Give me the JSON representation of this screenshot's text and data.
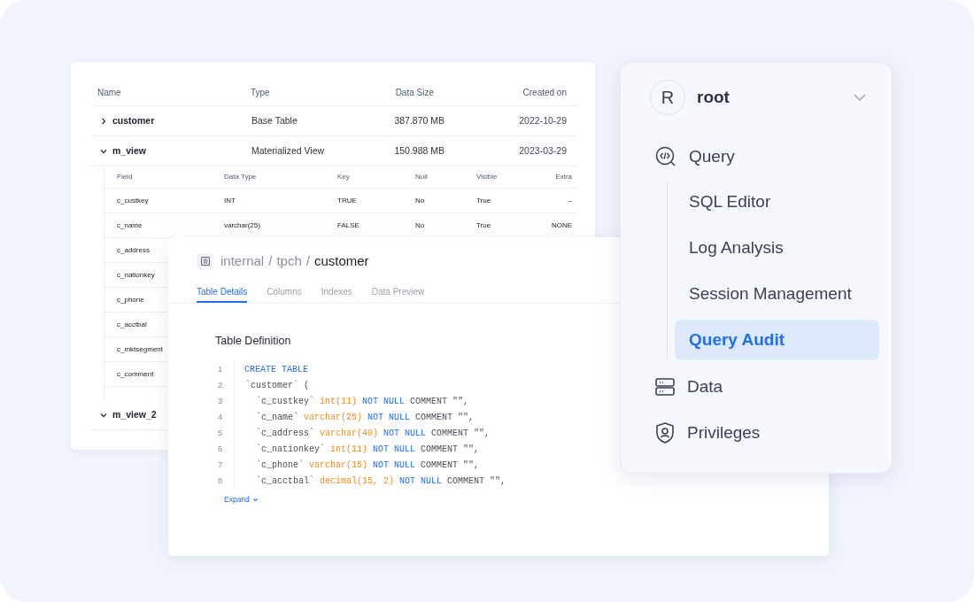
{
  "tables_card": {
    "columns": [
      "Name",
      "Type",
      "Data Size",
      "Created on"
    ],
    "rows": [
      {
        "name": "customer",
        "type": "Base Table",
        "size": "387.870 MB",
        "created": "2022-10-29",
        "expanded": false
      },
      {
        "name": "m_view",
        "type": "Materialized View",
        "size": "150.988 MB",
        "created": "2023-03-29",
        "expanded": true,
        "fields": {
          "columns": [
            "Field",
            "Data Type",
            "Key",
            "Null",
            "Visible",
            "Extra"
          ],
          "rows": [
            [
              "c_custkey",
              "INT",
              "TRUE",
              "No",
              "True",
              "–"
            ],
            [
              "c_name",
              "varchar(25)",
              "FALSE",
              "No",
              "True",
              "NONE"
            ],
            [
              "c_address"
            ],
            [
              "c_nationkey"
            ],
            [
              "c_phone"
            ],
            [
              "c_acctbal"
            ],
            [
              "c_mktsegment"
            ],
            [
              "c_comment"
            ]
          ]
        }
      },
      {
        "name": "m_view_2",
        "expanded": true
      }
    ]
  },
  "detail_card": {
    "breadcrumb": [
      {
        "kind": "link",
        "text": "internal"
      },
      {
        "kind": "separator",
        "text": "/"
      },
      {
        "kind": "link",
        "text": "tpch"
      },
      {
        "kind": "separator",
        "text": "/"
      },
      {
        "kind": "current",
        "text": "customer"
      }
    ],
    "tabs": [
      {
        "label": "Table Details",
        "selected": true
      },
      {
        "label": "Columns",
        "selected": false
      },
      {
        "label": "Indexes",
        "selected": false
      },
      {
        "label": "Data Preview",
        "selected": false
      }
    ],
    "section_title": "Table Definition",
    "code": [
      {
        "number": "1",
        "kind": "statement",
        "tokens": [
          {
            "kind": "keyword",
            "text": "CREATE TABLE"
          }
        ]
      },
      {
        "number": "2",
        "kind": "table",
        "tokens": [
          {
            "kind": "plain",
            "text": "`customer` ("
          }
        ]
      },
      {
        "number": "3",
        "kind": "column",
        "tokens": [
          {
            "kind": "plain",
            "text": "`c_custkey`"
          },
          {
            "kind": "type",
            "text": "int(11)"
          },
          {
            "kind": "keyword",
            "text": "NOT NULL"
          },
          {
            "kind": "plain",
            "text": "COMMENT \"\","
          }
        ]
      },
      {
        "number": "4",
        "kind": "column",
        "tokens": [
          {
            "kind": "plain",
            "text": "`c_name`"
          },
          {
            "kind": "type",
            "text": "varchar(25)"
          },
          {
            "kind": "keyword",
            "text": "NOT NULL"
          },
          {
            "kind": "plain",
            "text": "COMMENT \"\","
          }
        ]
      },
      {
        "number": "5",
        "kind": "column",
        "tokens": [
          {
            "kind": "plain",
            "text": "`c_address`"
          },
          {
            "kind": "type",
            "text": "varchar(40)"
          },
          {
            "kind": "keyword",
            "text": "NOT NULL"
          },
          {
            "kind": "plain",
            "text": "COMMENT \"\","
          }
        ]
      },
      {
        "number": "6",
        "kind": "column",
        "tokens": [
          {
            "kind": "plain",
            "text": "`c_nationkey`"
          },
          {
            "kind": "type",
            "text": "int(11)"
          },
          {
            "kind": "keyword",
            "text": "NOT NULL"
          },
          {
            "kind": "plain",
            "text": "COMMENT \"\","
          }
        ]
      },
      {
        "number": "7",
        "kind": "column",
        "tokens": [
          {
            "kind": "plain",
            "text": "`c_phone`"
          },
          {
            "kind": "type",
            "text": "varchar(15)"
          },
          {
            "kind": "keyword",
            "text": "NOT NULL"
          },
          {
            "kind": "plain",
            "text": "COMMENT \"\","
          }
        ]
      },
      {
        "number": "8",
        "kind": "column",
        "tokens": [
          {
            "kind": "plain",
            "text": "`c_acctbal`"
          },
          {
            "kind": "type",
            "text": "decimal(15, 2)"
          },
          {
            "kind": "keyword",
            "text": "NOT NULL"
          },
          {
            "kind": "plain",
            "text": "COMMENT \"\","
          }
        ]
      }
    ],
    "expand_link": "Expand"
  },
  "nav_panel": {
    "user": {
      "initial": "R",
      "name": "root"
    },
    "items": [
      {
        "label": "Query",
        "kind": "query",
        "children": [
          {
            "label": "SQL Editor",
            "selected": false
          },
          {
            "label": "Log Analysis",
            "selected": false
          },
          {
            "label": "Session Management",
            "selected": false
          },
          {
            "label": "Query Audit",
            "selected": true
          }
        ]
      },
      {
        "label": "Data",
        "kind": "data"
      },
      {
        "label": "Privileges",
        "kind": "privileges"
      }
    ]
  }
}
